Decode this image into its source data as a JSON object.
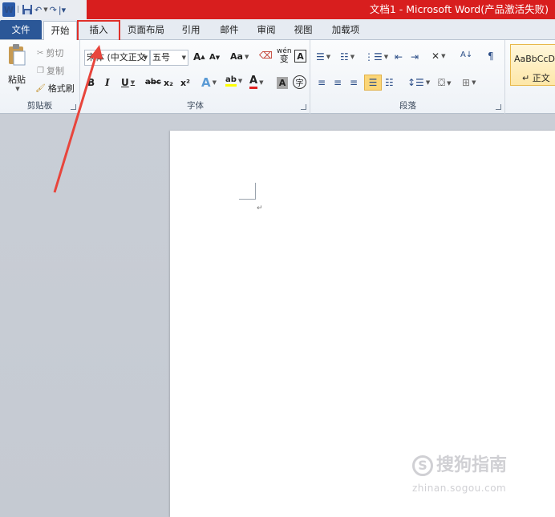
{
  "window": {
    "title": "文档1 - Microsoft Word(产品激活失败)"
  },
  "quick_access": {
    "logo": "W",
    "icons": [
      "word-icon",
      "save-icon",
      "undo-icon",
      "redo-icon",
      "customize-icon"
    ]
  },
  "tabs": [
    "文件",
    "开始",
    "插入",
    "页面布局",
    "引用",
    "邮件",
    "审阅",
    "视图",
    "加载项"
  ],
  "ribbon": {
    "clipboard": {
      "label": "剪贴板",
      "paste": "粘贴",
      "cut": "剪切",
      "copy": "复制",
      "format_painter": "格式刷"
    },
    "font": {
      "label": "字体",
      "font_name": "宋体 (中文正文",
      "font_size": "五号",
      "grow": "A",
      "shrink": "A",
      "change_case": "Aa",
      "phonetic": "wén",
      "bold": "B",
      "italic": "I",
      "underline": "U",
      "strike": "abc",
      "subscript": "x₂",
      "superscript": "x²",
      "effects": "A",
      "highlight": "ab",
      "font_color": "A",
      "char_shading": "A",
      "enclose": "字"
    },
    "paragraph": {
      "label": "段落"
    },
    "styles": {
      "sample": "AaBbCcDc",
      "normal": "↵ 正文"
    }
  },
  "document": {
    "paragraph_mark": "↵"
  },
  "watermark": {
    "brand": "搜狗指南",
    "url": "zhinan.sogou.com",
    "logo_letter": "S"
  },
  "colors": {
    "title_bar": "#d81e1e",
    "file_tab": "#2b5797",
    "annotation": "#e0302a"
  }
}
